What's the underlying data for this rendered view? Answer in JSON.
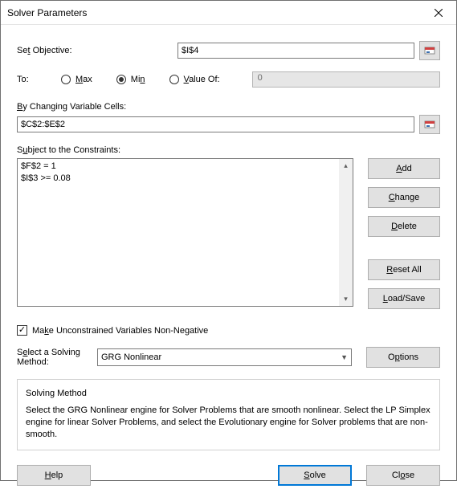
{
  "window": {
    "title": "Solver Parameters"
  },
  "objective": {
    "label": "Set Objective:",
    "value": "$I$4"
  },
  "to": {
    "label": "To:",
    "max": "Max",
    "min": "Min",
    "valueof": "Value Of:",
    "selected": "min",
    "valueof_value": "0"
  },
  "varcells": {
    "label": "By Changing Variable Cells:",
    "value": "$C$2:$E$2"
  },
  "constraints": {
    "label": "Subject to the Constraints:",
    "items": [
      "$F$2 = 1",
      "$I$3 >= 0.08"
    ]
  },
  "side": {
    "add": "Add",
    "change": "Change",
    "delete": "Delete",
    "resetall": "Reset All",
    "loadsave": "Load/Save"
  },
  "unconstrained": {
    "checked": true,
    "label": "Make Unconstrained Variables Non-Negative"
  },
  "method": {
    "label": "Select a Solving Method:",
    "value": "GRG Nonlinear",
    "options": "Options"
  },
  "group": {
    "title": "Solving Method",
    "text": "Select the GRG Nonlinear engine for Solver Problems that are smooth nonlinear. Select the LP Simplex engine for linear Solver Problems, and select the Evolutionary engine for Solver problems that are non-smooth."
  },
  "footer": {
    "help": "Help",
    "solve": "Solve",
    "close": "Close"
  }
}
